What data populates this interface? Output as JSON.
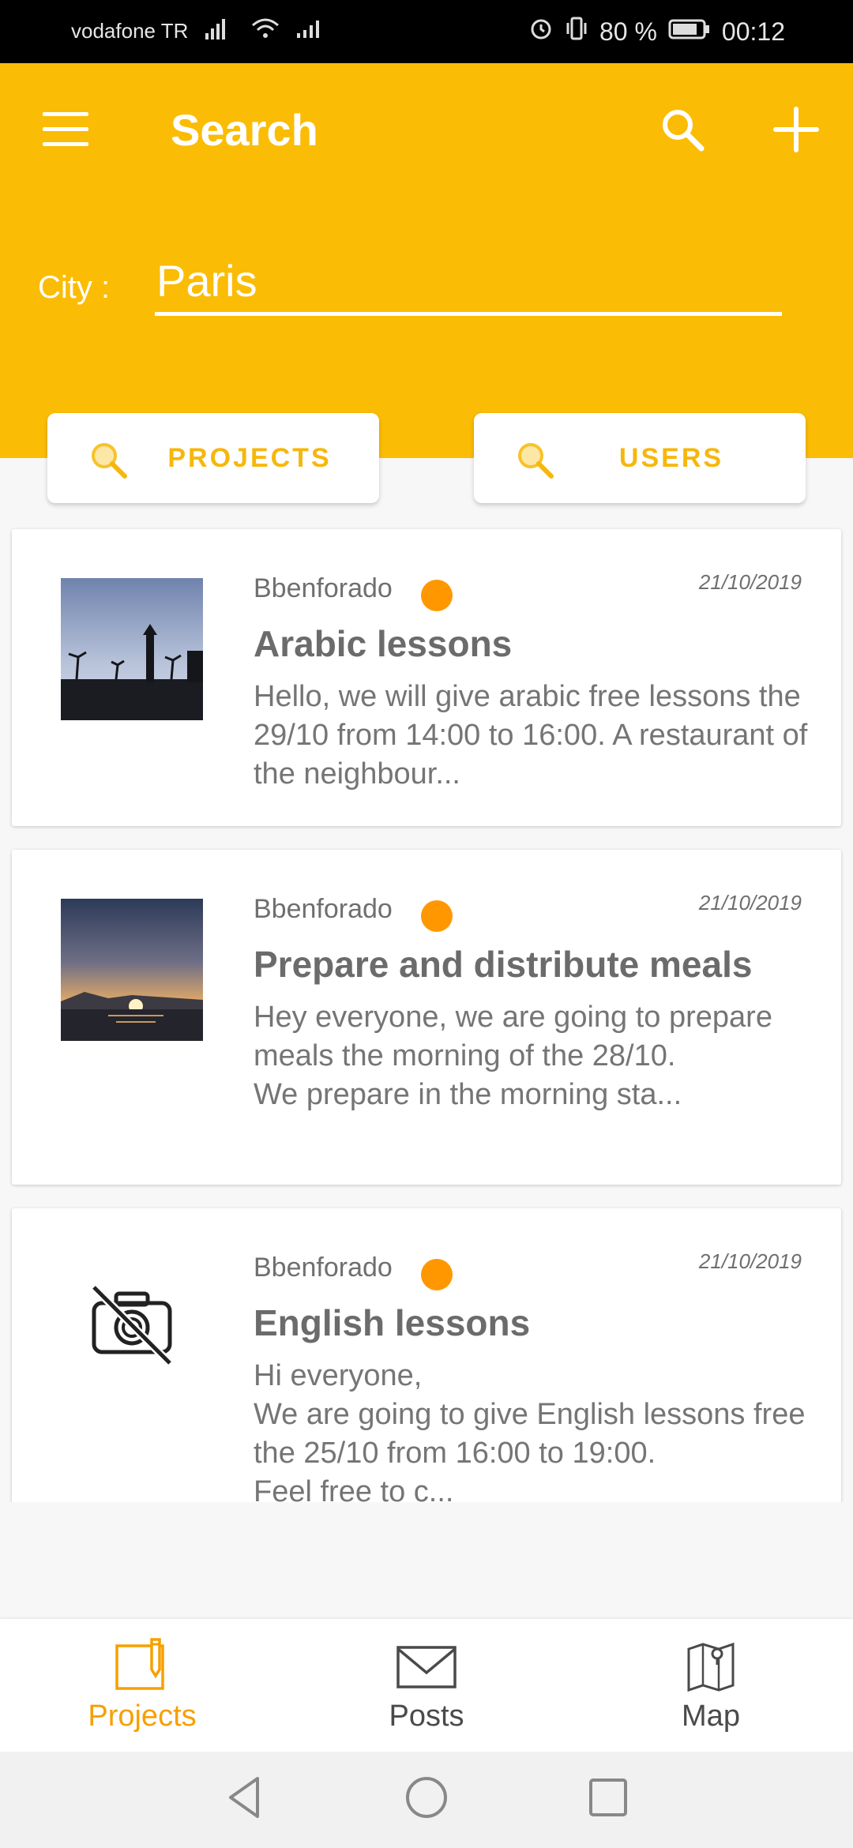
{
  "status_bar": {
    "carrier": "vodafone TR",
    "battery": "80 %",
    "time": "00:12"
  },
  "header": {
    "title": "Search",
    "city_label": "City :",
    "city_value": "Paris",
    "accent_color": "#fbbc05"
  },
  "filters": {
    "projects_label": "PROJECTS",
    "users_label": "USERS"
  },
  "cards": [
    {
      "author": "Bbenforado",
      "date": "21/10/2019",
      "title": "Arabic lessons",
      "body": "Hello, we will give arabic free lessons the 29/10 from 14:00 to 16:00. A restaurant of the neighbour...",
      "image": "city-silhouette-photo"
    },
    {
      "author": "Bbenforado",
      "date": "21/10/2019",
      "title": "Prepare and distribute meals",
      "body": "Hey everyone, we are going to prepare meals the morning of the 28/10.\nWe prepare in the morning sta...",
      "image": "sunset-sea-photo"
    },
    {
      "author": "Bbenforado",
      "date": "21/10/2019",
      "title": "English lessons",
      "body": "Hi everyone,\nWe are going to give English lessons free the 25/10 from 16:00 to 19:00.\nFeel free to c...",
      "image": "no-camera-icon"
    }
  ],
  "bottom_nav": {
    "projects": "Projects",
    "posts": "Posts",
    "map": "Map"
  }
}
